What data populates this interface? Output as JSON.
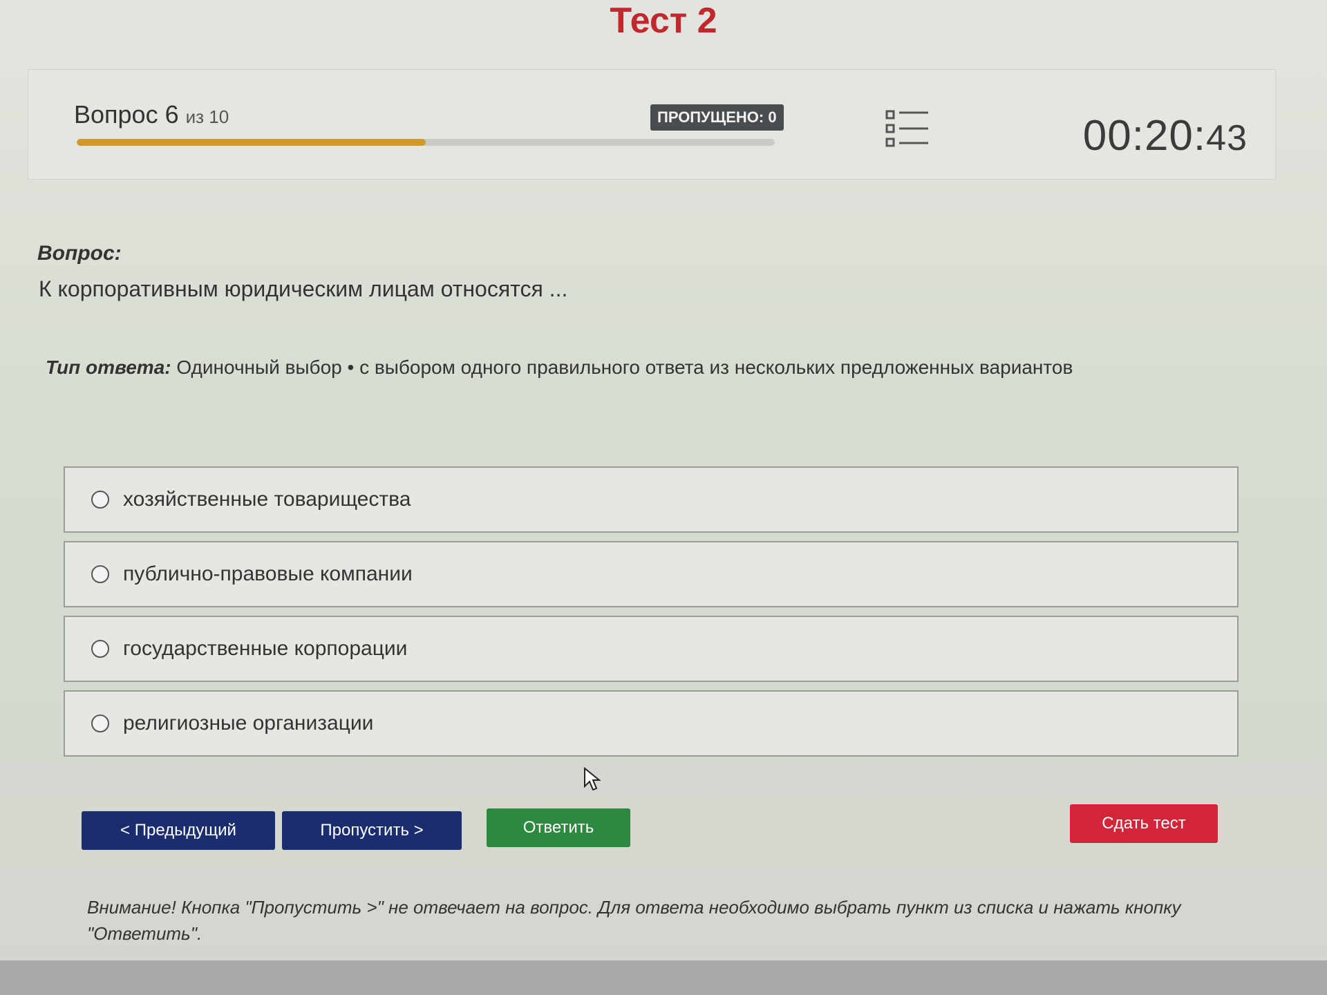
{
  "page_title": "Тест 2",
  "header": {
    "question_label": "Вопрос 6",
    "question_of": "из 10",
    "progress": 0.5,
    "skipped_label": "ПРОПУЩЕНО: 0",
    "timer_main": "00:20:",
    "timer_seconds": "43"
  },
  "question": {
    "label": "Вопрос:",
    "text": "К корпоративным юридическим лицам относятся ...",
    "answer_type_label": "Тип ответа:",
    "answer_type_value": "Одиночный выбор • с выбором одного правильного ответа из нескольких предложенных вариантов"
  },
  "options": [
    {
      "label": "хозяйственные товарищества"
    },
    {
      "label": "публично-правовые компании"
    },
    {
      "label": "государственные корпорации"
    },
    {
      "label": "религиозные организации"
    }
  ],
  "buttons": {
    "prev": "< Предыдущий",
    "skip": "Пропустить >",
    "answer": "Ответить",
    "submit": "Сдать тест"
  },
  "warning": "Внимание! Кнопка \"Пропустить >\" не отвечает на вопрос. Для ответа необходимо выбрать пункт из списка и нажать кнопку \"Ответить\".",
  "colors": {
    "title": "#c0282e",
    "progress_fill": "#d19a28",
    "nav_button": "#1a2d6e",
    "answer_button": "#2b8a3e",
    "submit_button": "#d3253a"
  },
  "icons": {
    "question_list": "list-icon",
    "cursor": "mouse-pointer-icon"
  }
}
